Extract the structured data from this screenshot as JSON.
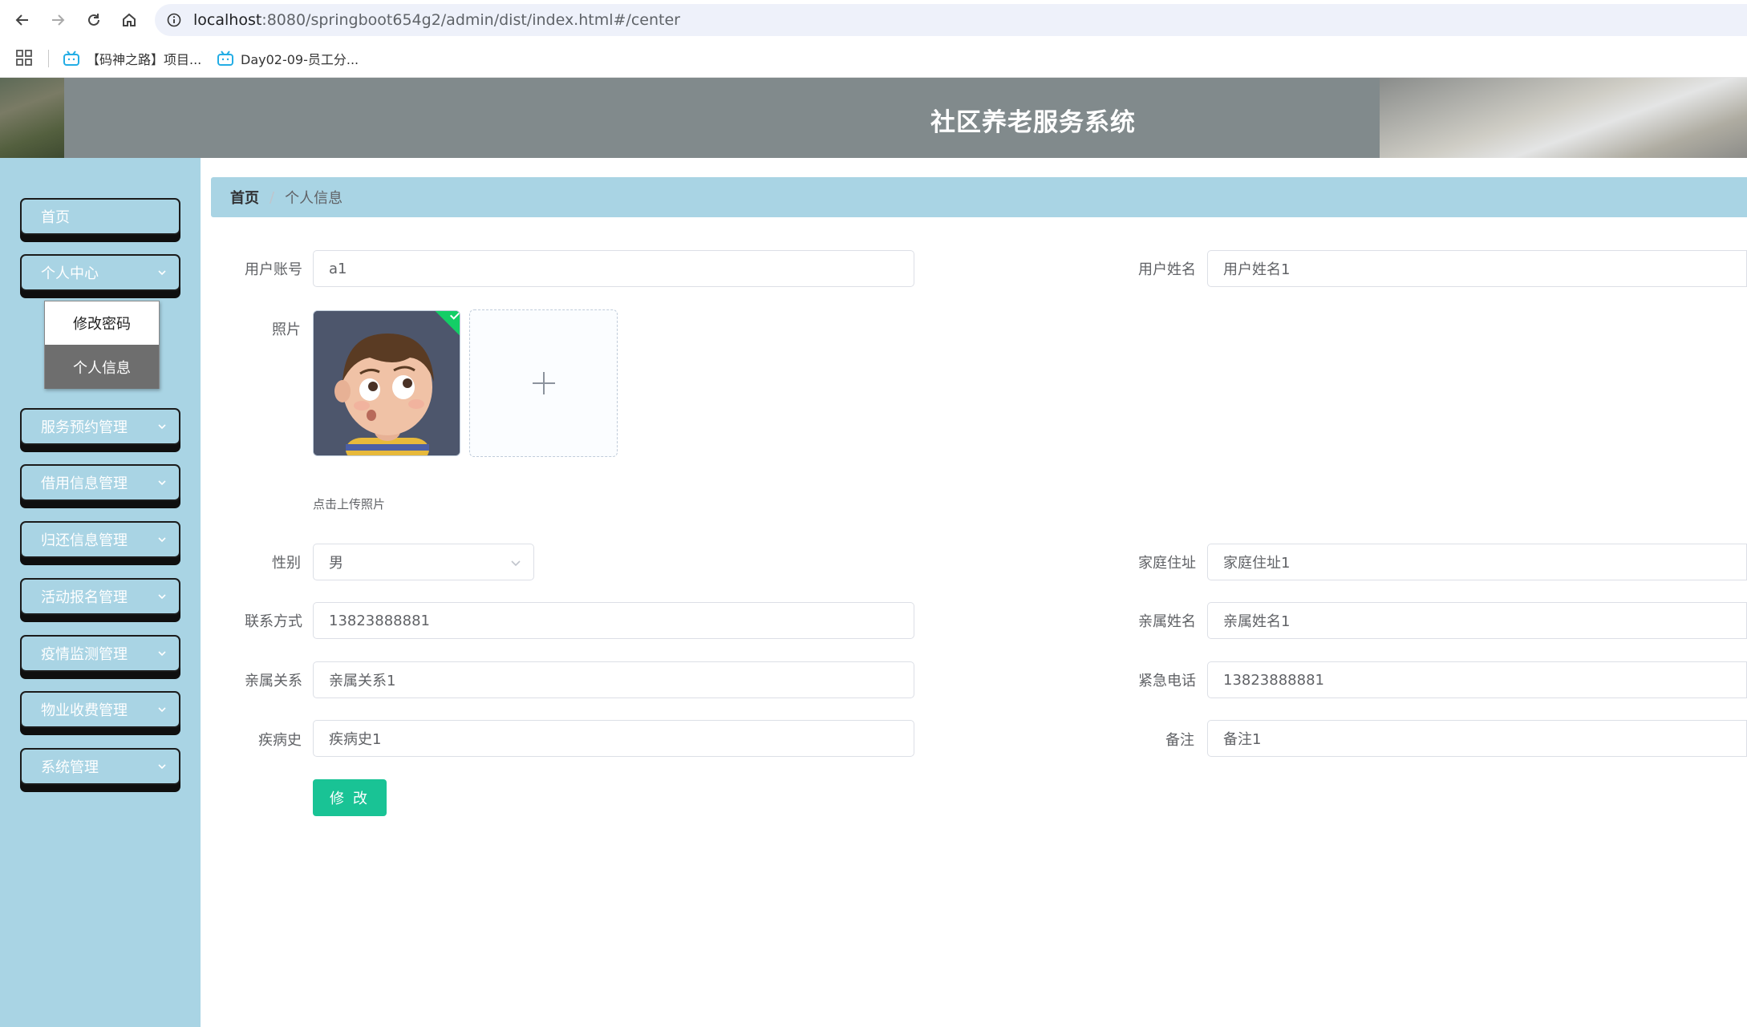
{
  "browser": {
    "url_host": "localhost",
    "url_rest": ":8080/springboot654g2/admin/dist/index.html#/center",
    "bookmarks": [
      {
        "label": "【码神之路】项目..."
      },
      {
        "label": "Day02-09-员工分..."
      }
    ]
  },
  "header": {
    "title": "社区养老服务系统"
  },
  "sidebar": {
    "items": [
      {
        "label": "首页"
      },
      {
        "label": "个人中心"
      },
      {
        "label": "服务预约管理"
      },
      {
        "label": "借用信息管理"
      },
      {
        "label": "归还信息管理"
      },
      {
        "label": "活动报名管理"
      },
      {
        "label": "疫情监测管理"
      },
      {
        "label": "物业收费管理"
      },
      {
        "label": "系统管理"
      }
    ],
    "submenu": [
      {
        "label": "修改密码"
      },
      {
        "label": "个人信息"
      }
    ]
  },
  "breadcrumb": {
    "home": "首页",
    "separator": "/",
    "current": "个人信息"
  },
  "form": {
    "account": {
      "label": "用户账号",
      "value": "a1"
    },
    "name": {
      "label": "用户姓名",
      "value": "用户姓名1"
    },
    "photo": {
      "label": "照片",
      "tip": "点击上传照片"
    },
    "gender": {
      "label": "性别",
      "value": "男"
    },
    "address": {
      "label": "家庭住址",
      "value": "家庭住址1"
    },
    "phone": {
      "label": "联系方式",
      "value": "13823888881"
    },
    "relative_name": {
      "label": "亲属姓名",
      "value": "亲属姓名1"
    },
    "relation": {
      "label": "亲属关系",
      "value": "亲属关系1"
    },
    "emergency_phone": {
      "label": "紧急电话",
      "value": "13823888881"
    },
    "medical_history": {
      "label": "疾病史",
      "value": "疾病史1"
    },
    "remark": {
      "label": "备注",
      "value": "备注1"
    },
    "submit_label": "修 改"
  },
  "colors": {
    "sidebar_bg": "#a9d4e4",
    "header_bg": "#818a8c",
    "submit_button": "#19c395",
    "active_submenu": "#6e6e6e"
  }
}
